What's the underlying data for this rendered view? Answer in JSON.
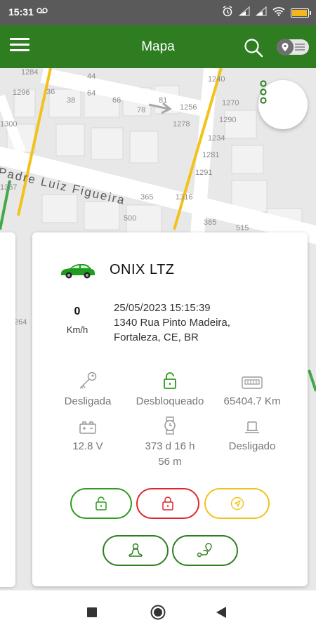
{
  "status_bar": {
    "time": "15:31",
    "left_icon": "voicemail-icon",
    "icons": [
      "alarm-icon",
      "signal-icon",
      "signal-icon",
      "wifi-icon",
      "battery-icon"
    ],
    "battery_percent": 95,
    "battery_color": "#f2b71b"
  },
  "app_bar": {
    "title": "Mapa",
    "color": "#2e7d21",
    "menu_icon": "hamburger-menu-icon",
    "search_icon": "search-icon",
    "toggle_icon": "map-list-toggle-icon"
  },
  "map": {
    "street_name": "Padre Luiz Figueira",
    "house_numbers": [
      "1284",
      "1296",
      "36",
      "38",
      "44",
      "64",
      "66",
      "78",
      "81",
      "1256",
      "1240",
      "1270",
      "1290",
      "1300",
      "1278",
      "1234",
      "1281",
      "1291",
      "1357",
      "365",
      "1316",
      "500",
      "385",
      "515",
      "264"
    ]
  },
  "vehicle": {
    "name": "ONIX LTZ",
    "speed": "0",
    "speed_unit": "Km/h",
    "datetime": "25/05/2023 15:15:39",
    "address_line1": "1340 Rua Pinto Madeira,",
    "address_line2": "Fortaleza, CE, BR",
    "stats": {
      "ignition": "Desligada",
      "lock_status": "Desbloqueado",
      "odometer": "65404.7 Km",
      "battery": "12.8 V",
      "time_line1": "373 d 16 h",
      "time_line2": "56 m",
      "device_status": "Desligado"
    },
    "colors": {
      "car": "#1f9d1f",
      "green": "#2e9a1e",
      "red": "#e0262e",
      "yellow": "#f2c21b",
      "dark_green": "#2e7d21"
    }
  },
  "actions": [
    "unlock-button",
    "lock-button",
    "navigate-button",
    "driver-button",
    "route-button"
  ],
  "nav_bar": {
    "buttons": [
      "recent-apps-icon",
      "home-icon",
      "back-icon"
    ]
  }
}
